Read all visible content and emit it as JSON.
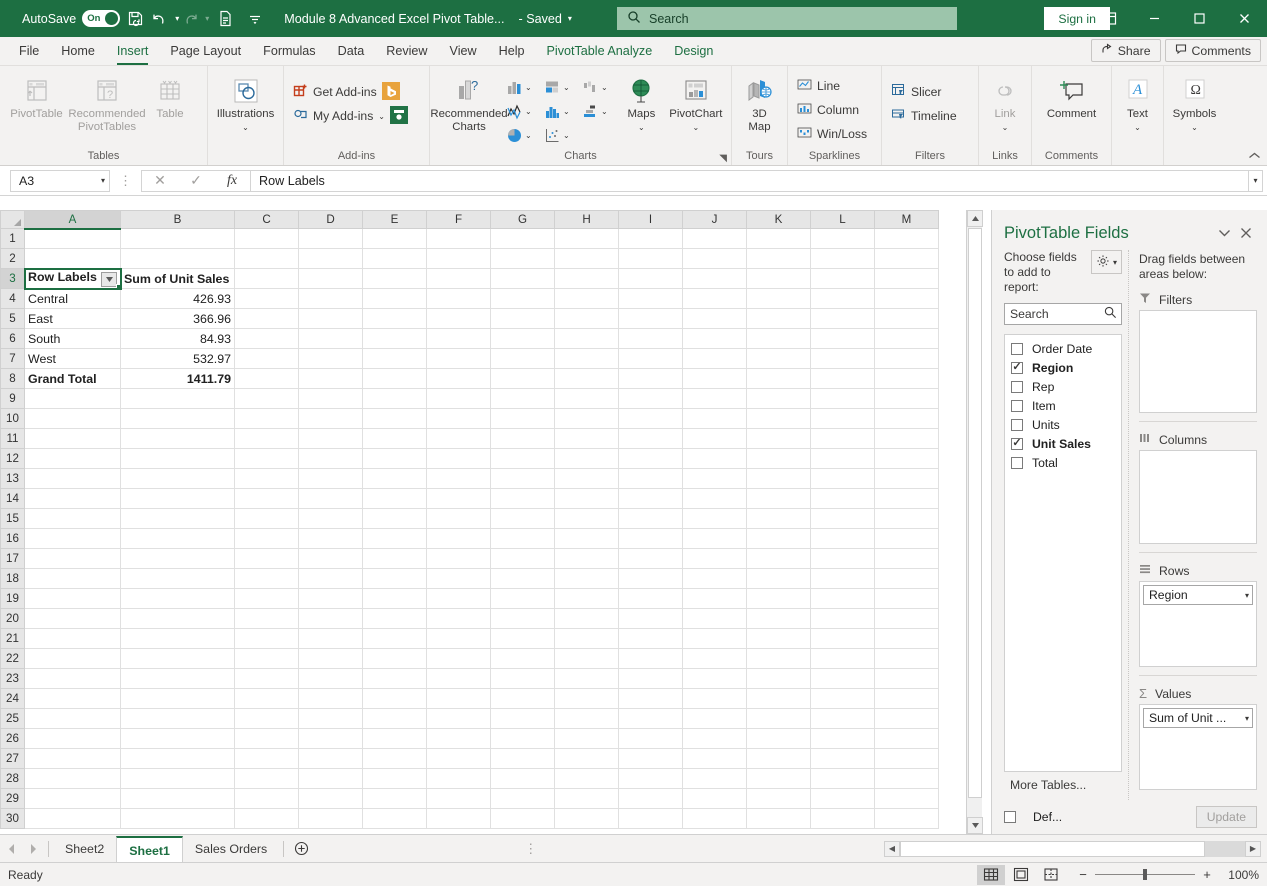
{
  "titlebar": {
    "autosave_label": "AutoSave",
    "autosave_state": "On",
    "doc_title": "Module 8 Advanced Excel Pivot Table...",
    "saved_status": "- Saved",
    "search_placeholder": "Search",
    "signin_label": "Sign in"
  },
  "tabs": [
    {
      "label": "File",
      "active": false
    },
    {
      "label": "Home",
      "active": false
    },
    {
      "label": "Insert",
      "active": true
    },
    {
      "label": "Page Layout",
      "active": false
    },
    {
      "label": "Formulas",
      "active": false
    },
    {
      "label": "Data",
      "active": false
    },
    {
      "label": "Review",
      "active": false
    },
    {
      "label": "View",
      "active": false
    },
    {
      "label": "Help",
      "active": false
    },
    {
      "label": "PivotTable Analyze",
      "active": false
    },
    {
      "label": "Design",
      "active": false
    }
  ],
  "tabbar_right": {
    "share_label": "Share",
    "comments_label": "Comments"
  },
  "ribbon": {
    "groups": [
      {
        "name": "Tables",
        "label": "Tables",
        "buttons": [
          {
            "label": "PivotTable",
            "disabled": true
          },
          {
            "label": "Recommended PivotTables",
            "disabled": true
          },
          {
            "label": "Table",
            "disabled": true
          }
        ]
      },
      {
        "name": "Illustrations",
        "label": "",
        "buttons": [
          {
            "label": "Illustrations",
            "disabled": false
          }
        ]
      },
      {
        "name": "Add-ins",
        "label": "Add-ins",
        "items": [
          {
            "label": "Get Add-ins"
          },
          {
            "label": "My Add-ins"
          }
        ]
      },
      {
        "name": "Charts",
        "label": "Charts",
        "buttons": [
          {
            "label": "Recommended Charts",
            "disabled": false
          }
        ],
        "chart_icons": [
          "column-chart-icon",
          "bar-chart-icon",
          "waterfall-chart-icon",
          "line-chart-icon",
          "statistic-chart-icon",
          "combo-chart-icon",
          "pie-chart-icon",
          "scatter-chart-icon"
        ],
        "extra": [
          {
            "label": "Maps"
          },
          {
            "label": "PivotChart"
          }
        ]
      },
      {
        "name": "Tours",
        "label": "Tours",
        "buttons": [
          {
            "label": "3D Map"
          }
        ]
      },
      {
        "name": "Sparklines",
        "label": "Sparklines",
        "items": [
          {
            "label": "Line"
          },
          {
            "label": "Column"
          },
          {
            "label": "Win/Loss"
          }
        ]
      },
      {
        "name": "Filters",
        "label": "Filters",
        "items": [
          {
            "label": "Slicer"
          },
          {
            "label": "Timeline"
          }
        ]
      },
      {
        "name": "Links",
        "label": "Links",
        "buttons": [
          {
            "label": "Link",
            "disabled": true
          }
        ]
      },
      {
        "name": "Comments",
        "label": "Comments",
        "buttons": [
          {
            "label": "Comment",
            "disabled": false
          }
        ]
      },
      {
        "name": "Text",
        "label": "",
        "buttons": [
          {
            "label": "Text"
          }
        ]
      },
      {
        "name": "Symbols",
        "label": "",
        "buttons": [
          {
            "label": "Symbols"
          }
        ]
      }
    ]
  },
  "formula_bar": {
    "name_box": "A3",
    "formula_value": "Row Labels",
    "cancel_icon": "close-icon",
    "confirm_icon": "check-icon",
    "function_icon": "fx"
  },
  "grid": {
    "columns": [
      "A",
      "B",
      "C",
      "D",
      "E",
      "F",
      "G",
      "H",
      "I",
      "J",
      "K",
      "L",
      "M"
    ],
    "rows": [
      1,
      2,
      3,
      4,
      5,
      6,
      7,
      8,
      9,
      10,
      11,
      12,
      13,
      14,
      15,
      16,
      17,
      18,
      19,
      20,
      21,
      22,
      23,
      24,
      25,
      26,
      27,
      28,
      29,
      30
    ],
    "selected_cell": "A3",
    "pivot": {
      "header_row": 3,
      "row_labels_header": "Row Labels",
      "value_header": "Sum of Unit Sales",
      "rows": [
        {
          "label": "Central",
          "value": "426.93"
        },
        {
          "label": "East",
          "value": "366.96"
        },
        {
          "label": "South",
          "value": "84.93"
        },
        {
          "label": "West",
          "value": "532.97"
        }
      ],
      "grand_total_label": "Grand Total",
      "grand_total_value": "1411.79"
    }
  },
  "chart_data": {
    "type": "table",
    "title": "Sum of Unit Sales",
    "categories": [
      "Central",
      "East",
      "South",
      "West"
    ],
    "values": [
      426.93,
      366.96,
      84.93,
      532.97
    ],
    "total": 1411.79,
    "xlabel": "Row Labels",
    "ylabel": "Sum of Unit Sales"
  },
  "pivot_panel": {
    "title": "PivotTable Fields",
    "menu_icon": "chevron-down-icon",
    "close_icon": "close-icon",
    "choose_label": "Choose fields to add to report:",
    "tools_icon": "gear-icon",
    "search_placeholder": "Search",
    "fields": [
      {
        "label": "Order Date",
        "checked": false
      },
      {
        "label": "Region",
        "checked": true
      },
      {
        "label": "Rep",
        "checked": false
      },
      {
        "label": "Item",
        "checked": false
      },
      {
        "label": "Units",
        "checked": false
      },
      {
        "label": "Unit Sales",
        "checked": true
      },
      {
        "label": "Total",
        "checked": false
      }
    ],
    "more_tables": "More Tables...",
    "drag_note": "Drag fields between areas below:",
    "areas": [
      {
        "name": "Filters",
        "icon": "filter-icon",
        "chips": []
      },
      {
        "name": "Columns",
        "icon": "columns-icon",
        "chips": []
      },
      {
        "name": "Rows",
        "icon": "rows-icon",
        "chips": [
          "Region"
        ]
      },
      {
        "name": "Values",
        "icon": "sigma-icon",
        "chips": [
          "Sum of Unit ..."
        ]
      }
    ],
    "defer_label": "Def...",
    "update_label": "Update"
  },
  "sheet_tabs": {
    "tabs": [
      {
        "label": "Sheet2",
        "active": false
      },
      {
        "label": "Sheet1",
        "active": true
      },
      {
        "label": "Sales Orders",
        "active": false
      }
    ],
    "add_label": "+"
  },
  "status_bar": {
    "status": "Ready",
    "views": [
      "normal-view-icon",
      "page-layout-view-icon",
      "page-break-view-icon"
    ],
    "zoom_out": "−",
    "zoom_in": "+",
    "zoom_level": "100%"
  }
}
